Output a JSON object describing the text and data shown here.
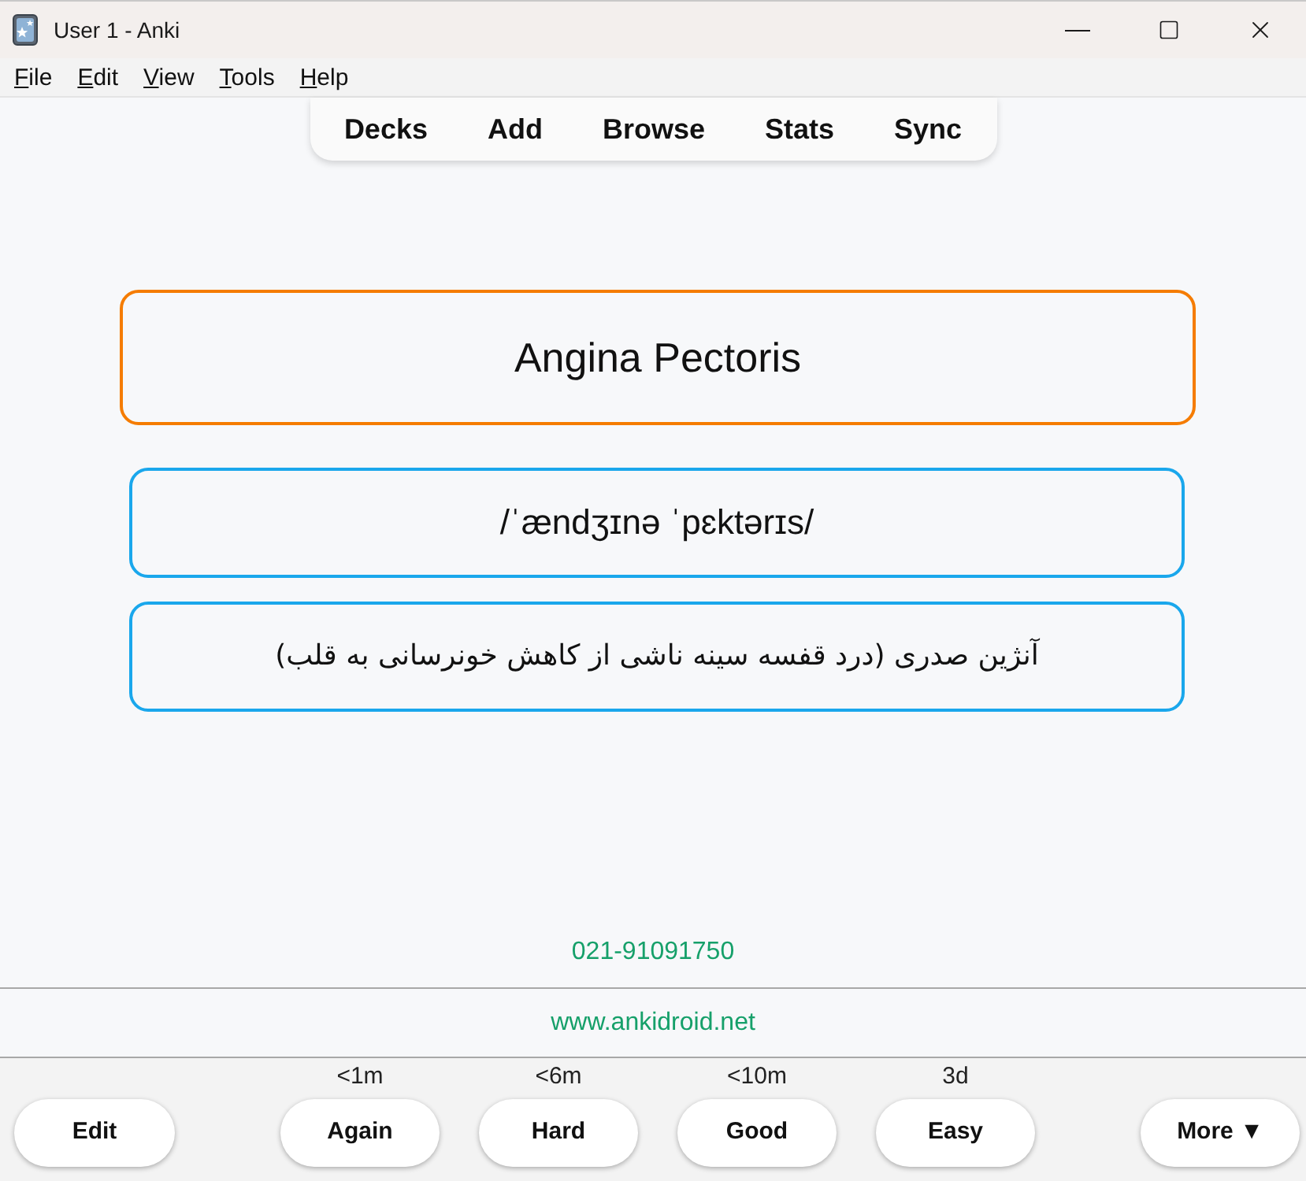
{
  "window": {
    "title": "User 1 - Anki"
  },
  "menu_bar": [
    "File",
    "Edit",
    "View",
    "Tools",
    "Help"
  ],
  "toolbar": [
    "Decks",
    "Add",
    "Browse",
    "Stats",
    "Sync"
  ],
  "card": {
    "fields": [
      {
        "kind": "term",
        "text": "Angina Pectoris",
        "color": "#f57c00"
      },
      {
        "kind": "pronunciation",
        "text": "/ˈændʒɪnə ˈpɛktərɪs/",
        "color": "#1aa7ec"
      },
      {
        "kind": "translation",
        "text": "آنژین صدری (درد قفسه سینه ناشی از کاهش خونرسانی به قلب)",
        "color": "#1aa7ec"
      }
    ],
    "phone": "021-91091750"
  },
  "link_bar": "www.ankidroid.net",
  "bottom_bar": {
    "edit_button": "Edit",
    "answer_buttons": [
      {
        "interval": "<1m",
        "label": "Again"
      },
      {
        "interval": "<6m",
        "label": "Hard"
      },
      {
        "interval": "<10m",
        "label": "Good"
      },
      {
        "interval": "3d",
        "label": "Easy"
      }
    ],
    "more_button": "More ▼"
  }
}
